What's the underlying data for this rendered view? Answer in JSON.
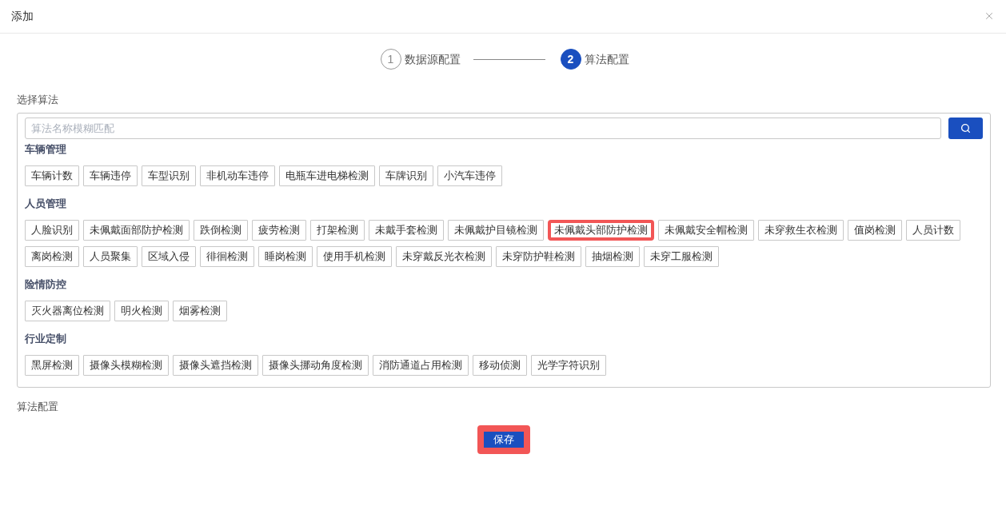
{
  "dialog": {
    "title": "添加"
  },
  "steps": [
    {
      "number": "1",
      "label": "数据源配置",
      "selected": false
    },
    {
      "number": "2",
      "label": "算法配置",
      "selected": true
    }
  ],
  "algorithm_section": {
    "label": "选择算法",
    "search": {
      "placeholder": "算法名称模糊匹配"
    },
    "categories": [
      {
        "title": "车辆管理",
        "tags": [
          {
            "label": "车辆计数",
            "highlighted": false
          },
          {
            "label": "车辆违停",
            "highlighted": false
          },
          {
            "label": "车型识别",
            "highlighted": false
          },
          {
            "label": "非机动车违停",
            "highlighted": false
          },
          {
            "label": "电瓶车进电梯检测",
            "highlighted": false
          },
          {
            "label": "车牌识别",
            "highlighted": false
          },
          {
            "label": "小汽车违停",
            "highlighted": false
          }
        ]
      },
      {
        "title": "人员管理",
        "tags": [
          {
            "label": "人脸识别",
            "highlighted": false
          },
          {
            "label": "未佩戴面部防护检测",
            "highlighted": false
          },
          {
            "label": "跌倒检测",
            "highlighted": false
          },
          {
            "label": "疲劳检测",
            "highlighted": false
          },
          {
            "label": "打架检测",
            "highlighted": false
          },
          {
            "label": "未戴手套检测",
            "highlighted": false
          },
          {
            "label": "未佩戴护目镜检测",
            "highlighted": false
          },
          {
            "label": "未佩戴头部防护检测",
            "highlighted": true
          },
          {
            "label": "未佩戴安全帽检测",
            "highlighted": false
          },
          {
            "label": "未穿救生衣检测",
            "highlighted": false
          },
          {
            "label": "值岗检测",
            "highlighted": false
          },
          {
            "label": "人员计数",
            "highlighted": false
          },
          {
            "label": "离岗检测",
            "highlighted": false
          },
          {
            "label": "人员聚集",
            "highlighted": false
          },
          {
            "label": "区域入侵",
            "highlighted": false
          },
          {
            "label": "徘徊检测",
            "highlighted": false
          },
          {
            "label": "睡岗检测",
            "highlighted": false
          },
          {
            "label": "使用手机检测",
            "highlighted": false
          },
          {
            "label": "未穿戴反光衣检测",
            "highlighted": false
          },
          {
            "label": "未穿防护鞋检测",
            "highlighted": false
          },
          {
            "label": "抽烟检测",
            "highlighted": false
          },
          {
            "label": "未穿工服检测",
            "highlighted": false
          }
        ]
      },
      {
        "title": "险情防控",
        "tags": [
          {
            "label": "灭火器离位检测",
            "highlighted": false
          },
          {
            "label": "明火检测",
            "highlighted": false
          },
          {
            "label": "烟雾检测",
            "highlighted": false
          }
        ]
      },
      {
        "title": "行业定制",
        "tags": [
          {
            "label": "黑屏检测",
            "highlighted": false
          },
          {
            "label": "摄像头模糊检测",
            "highlighted": false
          },
          {
            "label": "摄像头遮挡检测",
            "highlighted": false
          },
          {
            "label": "摄像头挪动角度检测",
            "highlighted": false
          },
          {
            "label": "消防通道占用检测",
            "highlighted": false
          },
          {
            "label": "移动侦测",
            "highlighted": false
          },
          {
            "label": "光学字符识别",
            "highlighted": false
          }
        ]
      }
    ]
  },
  "config_section": {
    "label": "算法配置"
  },
  "save_button": {
    "label": "保存",
    "highlighted": true
  }
}
